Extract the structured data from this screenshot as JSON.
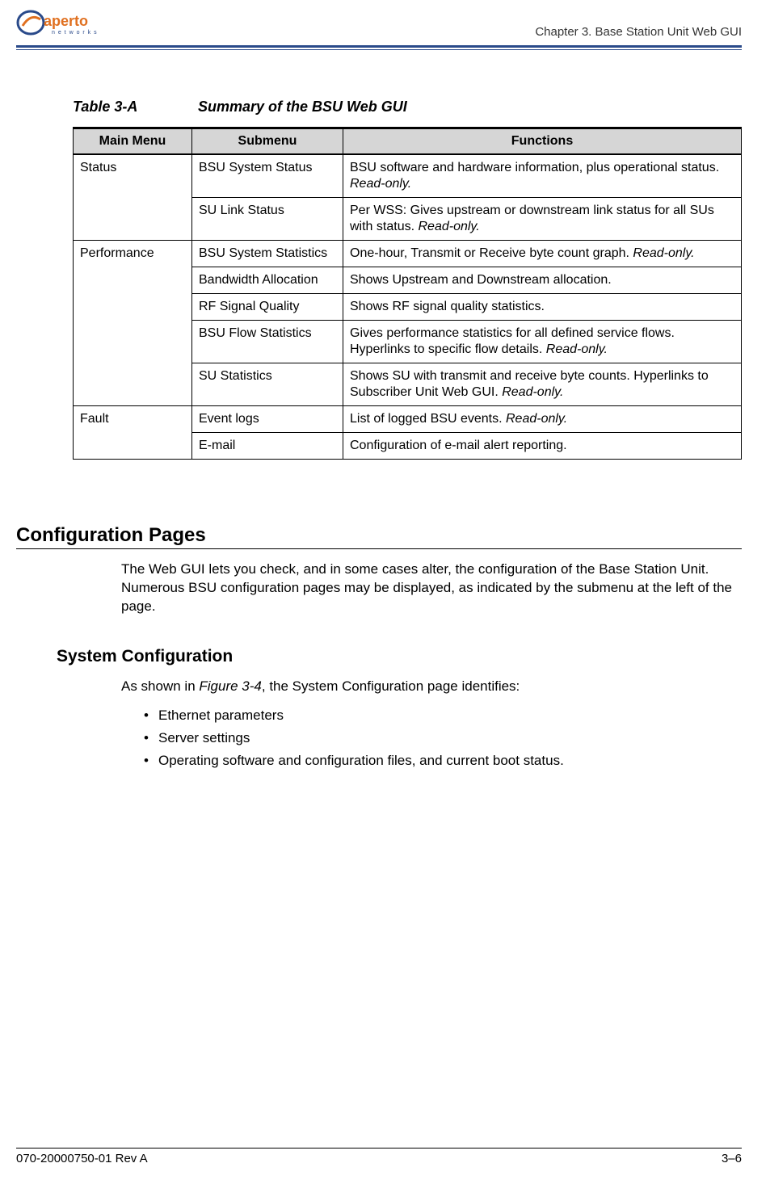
{
  "header": {
    "chapter": "Chapter 3.  Base Station Unit Web GUI",
    "logo_brand": "aperto",
    "logo_sub": "n e t w o r k s"
  },
  "table": {
    "label": "Table 3-A",
    "title": "Summary of the BSU Web GUI",
    "headers": {
      "c1": "Main Menu",
      "c2": "Submenu",
      "c3": "Functions"
    },
    "rows": {
      "r1_main": "Status",
      "r1_sub": "BSU System Status",
      "r1_fn_a": "BSU software and hardware information, plus operational status. ",
      "r1_fn_ro": "Read-only.",
      "r2_sub": "SU Link Status",
      "r2_fn_a": "Per WSS: Gives upstream or downstream link status for all SUs with status. ",
      "r2_fn_ro": "Read-only.",
      "r3_main": "Performance",
      "r3_sub": "BSU System Statistics",
      "r3_fn_a": "One-hour, Transmit or Receive byte count graph. ",
      "r3_fn_ro": "Read-only.",
      "r4_sub": "Bandwidth Allocation",
      "r4_fn": "Shows Upstream and Downstream allocation.",
      "r5_sub": "RF Signal Quality",
      "r5_fn": "Shows RF signal quality statistics.",
      "r6_sub": "BSU Flow Statistics",
      "r6_fn_a": "Gives performance statistics for all defined service flows. Hyperlinks to specific flow details. ",
      "r6_fn_ro": "Read-only.",
      "r7_sub": "SU Statistics",
      "r7_fn_a": "Shows SU with transmit and receive byte counts. Hyper­links to Subscriber Unit Web GUI. ",
      "r7_fn_ro": "Read-only.",
      "r8_main": "Fault",
      "r8_sub": "Event logs",
      "r8_fn_a": "List of logged BSU events. ",
      "r8_fn_ro": "Read-only.",
      "r9_sub": "E-mail",
      "r9_fn": "Configuration of e-mail alert reporting."
    }
  },
  "section": {
    "h1": "Configuration Pages",
    "p1": "The Web GUI lets you check, and in some cases alter, the configuration of the Base Station Unit. Numerous BSU configuration pages may be displayed, as indicated by the submenu at the left of the page.",
    "h2": "System Configuration",
    "p2_a": "As shown in ",
    "p2_ref": "Figure 3-4",
    "p2_b": ", the System Configuration page identifies:",
    "bullets": {
      "b1": "Ethernet parameters",
      "b2": "Server settings",
      "b3": "Operating software and configuration files, and current boot status."
    }
  },
  "footer": {
    "left": "070-20000750-01 Rev A",
    "right": "3–6"
  }
}
